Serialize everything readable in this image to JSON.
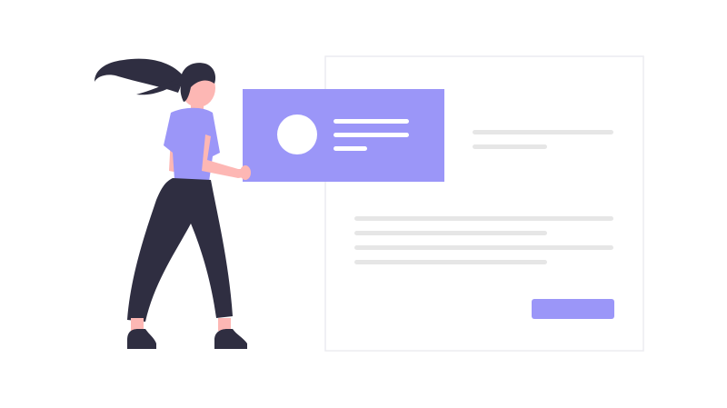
{
  "colors": {
    "background": "#ffffff",
    "accent": "#9b96f8",
    "document": "#ffffff",
    "document_border": "#ececf0",
    "placeholder_line": "#e6e6e6",
    "hair": "#2f2e41",
    "skin": "#fdb7b4",
    "pants": "#2f2e41",
    "shirt": "#9b96f8",
    "shoes": "#2f2e41"
  },
  "icons": {
    "profile_avatar": "avatar-circle-icon",
    "submit_button": "button-placeholder-icon"
  }
}
